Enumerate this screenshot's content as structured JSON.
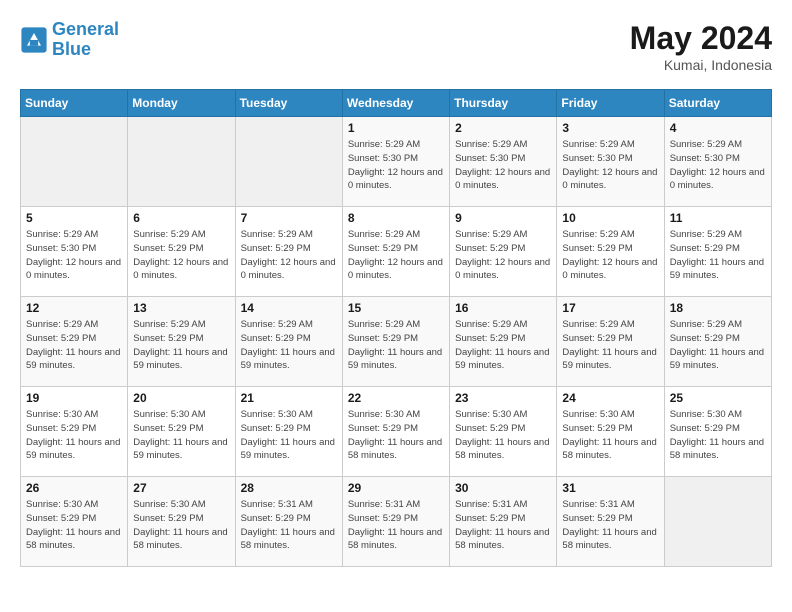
{
  "header": {
    "logo_line1": "General",
    "logo_line2": "Blue",
    "month": "May 2024",
    "location": "Kumai, Indonesia"
  },
  "weekdays": [
    "Sunday",
    "Monday",
    "Tuesday",
    "Wednesday",
    "Thursday",
    "Friday",
    "Saturday"
  ],
  "weeks": [
    [
      {
        "day": "",
        "sunrise": "",
        "sunset": "",
        "daylight": "",
        "empty": true
      },
      {
        "day": "",
        "sunrise": "",
        "sunset": "",
        "daylight": "",
        "empty": true
      },
      {
        "day": "",
        "sunrise": "",
        "sunset": "",
        "daylight": "",
        "empty": true
      },
      {
        "day": "1",
        "sunrise": "Sunrise: 5:29 AM",
        "sunset": "Sunset: 5:30 PM",
        "daylight": "Daylight: 12 hours and 0 minutes."
      },
      {
        "day": "2",
        "sunrise": "Sunrise: 5:29 AM",
        "sunset": "Sunset: 5:30 PM",
        "daylight": "Daylight: 12 hours and 0 minutes."
      },
      {
        "day": "3",
        "sunrise": "Sunrise: 5:29 AM",
        "sunset": "Sunset: 5:30 PM",
        "daylight": "Daylight: 12 hours and 0 minutes."
      },
      {
        "day": "4",
        "sunrise": "Sunrise: 5:29 AM",
        "sunset": "Sunset: 5:30 PM",
        "daylight": "Daylight: 12 hours and 0 minutes."
      }
    ],
    [
      {
        "day": "5",
        "sunrise": "Sunrise: 5:29 AM",
        "sunset": "Sunset: 5:30 PM",
        "daylight": "Daylight: 12 hours and 0 minutes."
      },
      {
        "day": "6",
        "sunrise": "Sunrise: 5:29 AM",
        "sunset": "Sunset: 5:29 PM",
        "daylight": "Daylight: 12 hours and 0 minutes."
      },
      {
        "day": "7",
        "sunrise": "Sunrise: 5:29 AM",
        "sunset": "Sunset: 5:29 PM",
        "daylight": "Daylight: 12 hours and 0 minutes."
      },
      {
        "day": "8",
        "sunrise": "Sunrise: 5:29 AM",
        "sunset": "Sunset: 5:29 PM",
        "daylight": "Daylight: 12 hours and 0 minutes."
      },
      {
        "day": "9",
        "sunrise": "Sunrise: 5:29 AM",
        "sunset": "Sunset: 5:29 PM",
        "daylight": "Daylight: 12 hours and 0 minutes."
      },
      {
        "day": "10",
        "sunrise": "Sunrise: 5:29 AM",
        "sunset": "Sunset: 5:29 PM",
        "daylight": "Daylight: 12 hours and 0 minutes."
      },
      {
        "day": "11",
        "sunrise": "Sunrise: 5:29 AM",
        "sunset": "Sunset: 5:29 PM",
        "daylight": "Daylight: 11 hours and 59 minutes."
      }
    ],
    [
      {
        "day": "12",
        "sunrise": "Sunrise: 5:29 AM",
        "sunset": "Sunset: 5:29 PM",
        "daylight": "Daylight: 11 hours and 59 minutes."
      },
      {
        "day": "13",
        "sunrise": "Sunrise: 5:29 AM",
        "sunset": "Sunset: 5:29 PM",
        "daylight": "Daylight: 11 hours and 59 minutes."
      },
      {
        "day": "14",
        "sunrise": "Sunrise: 5:29 AM",
        "sunset": "Sunset: 5:29 PM",
        "daylight": "Daylight: 11 hours and 59 minutes."
      },
      {
        "day": "15",
        "sunrise": "Sunrise: 5:29 AM",
        "sunset": "Sunset: 5:29 PM",
        "daylight": "Daylight: 11 hours and 59 minutes."
      },
      {
        "day": "16",
        "sunrise": "Sunrise: 5:29 AM",
        "sunset": "Sunset: 5:29 PM",
        "daylight": "Daylight: 11 hours and 59 minutes."
      },
      {
        "day": "17",
        "sunrise": "Sunrise: 5:29 AM",
        "sunset": "Sunset: 5:29 PM",
        "daylight": "Daylight: 11 hours and 59 minutes."
      },
      {
        "day": "18",
        "sunrise": "Sunrise: 5:29 AM",
        "sunset": "Sunset: 5:29 PM",
        "daylight": "Daylight: 11 hours and 59 minutes."
      }
    ],
    [
      {
        "day": "19",
        "sunrise": "Sunrise: 5:30 AM",
        "sunset": "Sunset: 5:29 PM",
        "daylight": "Daylight: 11 hours and 59 minutes."
      },
      {
        "day": "20",
        "sunrise": "Sunrise: 5:30 AM",
        "sunset": "Sunset: 5:29 PM",
        "daylight": "Daylight: 11 hours and 59 minutes."
      },
      {
        "day": "21",
        "sunrise": "Sunrise: 5:30 AM",
        "sunset": "Sunset: 5:29 PM",
        "daylight": "Daylight: 11 hours and 59 minutes."
      },
      {
        "day": "22",
        "sunrise": "Sunrise: 5:30 AM",
        "sunset": "Sunset: 5:29 PM",
        "daylight": "Daylight: 11 hours and 58 minutes."
      },
      {
        "day": "23",
        "sunrise": "Sunrise: 5:30 AM",
        "sunset": "Sunset: 5:29 PM",
        "daylight": "Daylight: 11 hours and 58 minutes."
      },
      {
        "day": "24",
        "sunrise": "Sunrise: 5:30 AM",
        "sunset": "Sunset: 5:29 PM",
        "daylight": "Daylight: 11 hours and 58 minutes."
      },
      {
        "day": "25",
        "sunrise": "Sunrise: 5:30 AM",
        "sunset": "Sunset: 5:29 PM",
        "daylight": "Daylight: 11 hours and 58 minutes."
      }
    ],
    [
      {
        "day": "26",
        "sunrise": "Sunrise: 5:30 AM",
        "sunset": "Sunset: 5:29 PM",
        "daylight": "Daylight: 11 hours and 58 minutes."
      },
      {
        "day": "27",
        "sunrise": "Sunrise: 5:30 AM",
        "sunset": "Sunset: 5:29 PM",
        "daylight": "Daylight: 11 hours and 58 minutes."
      },
      {
        "day": "28",
        "sunrise": "Sunrise: 5:31 AM",
        "sunset": "Sunset: 5:29 PM",
        "daylight": "Daylight: 11 hours and 58 minutes."
      },
      {
        "day": "29",
        "sunrise": "Sunrise: 5:31 AM",
        "sunset": "Sunset: 5:29 PM",
        "daylight": "Daylight: 11 hours and 58 minutes."
      },
      {
        "day": "30",
        "sunrise": "Sunrise: 5:31 AM",
        "sunset": "Sunset: 5:29 PM",
        "daylight": "Daylight: 11 hours and 58 minutes."
      },
      {
        "day": "31",
        "sunrise": "Sunrise: 5:31 AM",
        "sunset": "Sunset: 5:29 PM",
        "daylight": "Daylight: 11 hours and 58 minutes."
      },
      {
        "day": "",
        "sunrise": "",
        "sunset": "",
        "daylight": "",
        "empty": true
      }
    ]
  ]
}
